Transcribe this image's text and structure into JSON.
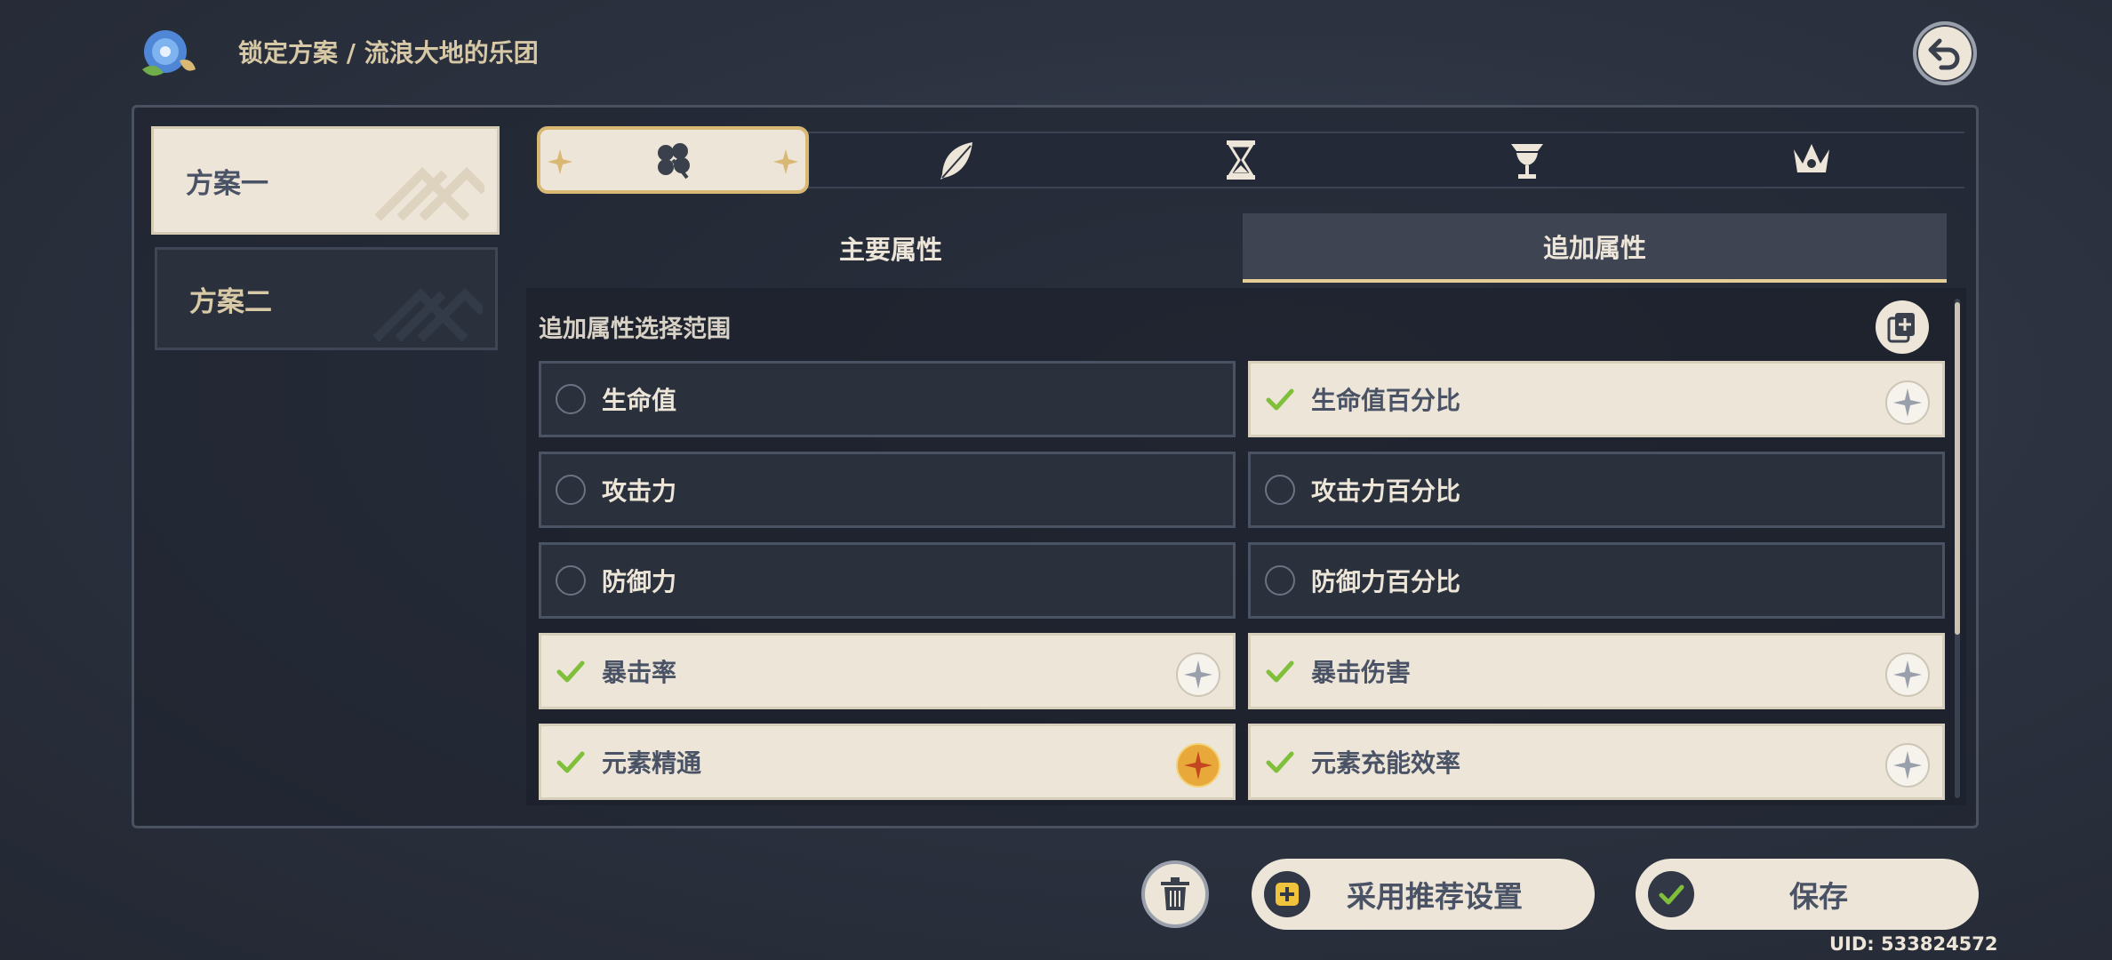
{
  "header": {
    "breadcrumb": "锁定方案 / 流浪大地的乐团",
    "logo_icon": "morning-glory-logo-icon",
    "back_icon": "back-arrow-icon"
  },
  "plans": [
    {
      "label": "方案一",
      "selected": true
    },
    {
      "label": "方案二",
      "selected": false
    }
  ],
  "slots": [
    {
      "icon": "flower-icon",
      "selected": true
    },
    {
      "icon": "feather-icon",
      "selected": false
    },
    {
      "icon": "hourglass-icon",
      "selected": false
    },
    {
      "icon": "goblet-icon",
      "selected": false
    },
    {
      "icon": "crown-icon",
      "selected": false
    }
  ],
  "attribute_tabs": {
    "main_label": "主要属性",
    "extra_label": "追加属性",
    "selected": "extra"
  },
  "section": {
    "title": "追加属性选择范围",
    "copy_icon": "copy-add-icon"
  },
  "options": [
    {
      "label": "生命值",
      "checked": false
    },
    {
      "label": "生命值百分比",
      "checked": true,
      "star": "plain"
    },
    {
      "label": "攻击力",
      "checked": false
    },
    {
      "label": "攻击力百分比",
      "checked": false
    },
    {
      "label": "防御力",
      "checked": false
    },
    {
      "label": "防御力百分比",
      "checked": false
    },
    {
      "label": "暴击率",
      "checked": true,
      "star": "plain"
    },
    {
      "label": "暴击伤害",
      "checked": true,
      "star": "plain"
    },
    {
      "label": "元素精通",
      "checked": true,
      "star": "gold"
    },
    {
      "label": "元素充能效率",
      "checked": true,
      "star": "plain"
    }
  ],
  "footer": {
    "trash_icon": "trash-icon",
    "recommend_label": "采用推荐设置",
    "save_label": "保存",
    "uid": "UID: 533824572"
  },
  "colors": {
    "cream": "#ece5d8",
    "gold_accent": "#e6cf97",
    "check_green": "#7fbf3a",
    "dark_panel": "#2a303c"
  }
}
